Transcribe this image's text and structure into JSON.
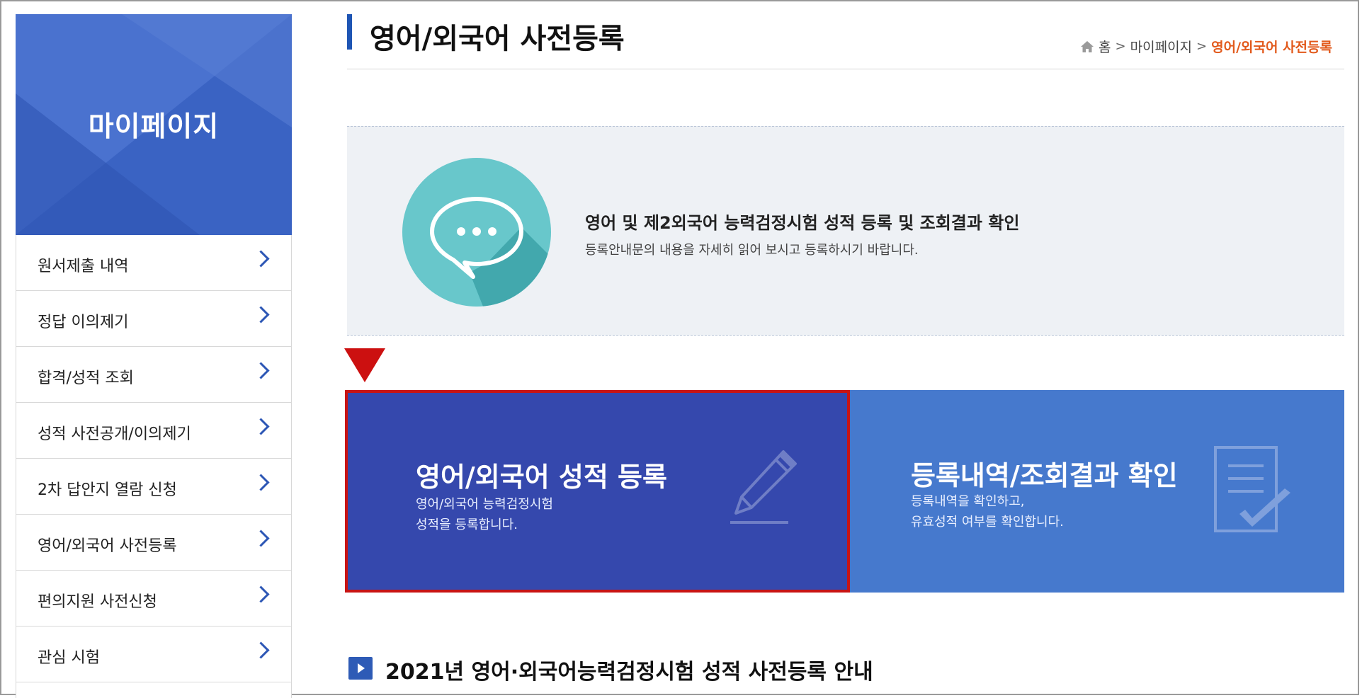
{
  "sidebar": {
    "title": "마이페이지",
    "items": [
      {
        "label": "원서제출 내역"
      },
      {
        "label": "정답 이의제기"
      },
      {
        "label": "합격/성적 조회"
      },
      {
        "label": "성적 사전공개/이의제기"
      },
      {
        "label": "2차 답안지 열람 신청"
      },
      {
        "label": "영어/외국어 사전등록"
      },
      {
        "label": "편의지원 사전신청"
      },
      {
        "label": "관심 시험"
      }
    ]
  },
  "header": {
    "title": "영어/외국어 사전등록",
    "breadcrumb": {
      "home": "홈",
      "sep": ">",
      "level1": "마이페이지",
      "current": "영어/외국어 사전등록"
    }
  },
  "info": {
    "title": "영어 및 제2외국어 능력검정시험 성적 등록 및 조회결과 확인",
    "desc": "등록안내문의 내용을 자세히 읽어 보시고 등록하시기 바랍니다."
  },
  "cards": {
    "register": {
      "title": "영어/외국어 성적 등록",
      "desc1": "영어/외국어 능력검정시험",
      "desc2": "성적을 등록합니다."
    },
    "history": {
      "title": "등록내역/조회결과 확인",
      "desc1": "등록내역을 확인하고,",
      "desc2": "유효성적 여부를 확인합니다."
    }
  },
  "section": {
    "title": "2021년 영어·외국어능력검정시험 성적 사전등록 안내"
  },
  "colors": {
    "sidebar_head": "#3a63c3",
    "card_register": "#3548ad",
    "card_history": "#4679cd",
    "highlight_border": "#c81414",
    "breadcrumb_current": "#e25a1c",
    "chat_icon_bg": "#68c7cb"
  },
  "icons": {
    "breadcrumb_home": "home-icon",
    "menu_arrow": "chevron-right-icon",
    "info": "chat-bubble-icon",
    "register": "pencil-icon",
    "history": "document-check-icon",
    "indicator": "down-triangle-icon",
    "section": "play-square-icon"
  }
}
